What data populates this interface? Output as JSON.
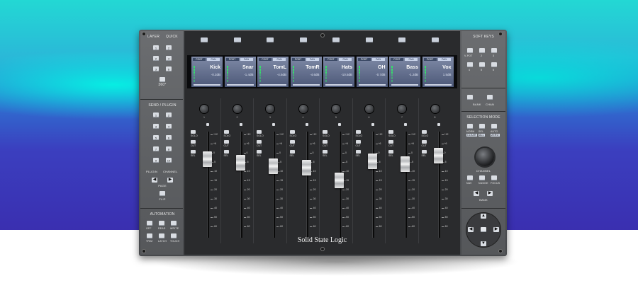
{
  "brand": "Solid State Logic",
  "left_panel": {
    "layer_label": "LAYER",
    "quick_label": "QUICK",
    "layer_numbers": [
      "1",
      "2",
      "3"
    ],
    "quick_numbers": [
      "1",
      "2",
      "3",
      "4",
      "5",
      "6"
    ],
    "ssl360_label": "360°",
    "send_plugin_label": "SEND / PLUGIN",
    "send_numbers": [
      "1",
      "2",
      "3",
      "4",
      "5",
      "6",
      "7",
      "8",
      "9",
      "10"
    ],
    "plugin_label": "PLUGIN",
    "channel_label": "CHANNEL",
    "page_label": "PAGE",
    "flip_label": "FLIP",
    "automation_label": "AUTOMATION",
    "automation_buttons": [
      "OFF",
      "READ",
      "WRITE",
      "TRIM",
      "LATCH",
      "TOUCH"
    ]
  },
  "channels": [
    {
      "name": "Kick",
      "value": "-0.2dB"
    },
    {
      "name": "Snar",
      "value": "-1.4dB"
    },
    {
      "name": "TomL",
      "value": "-4.5dB"
    },
    {
      "name": "TomR",
      "value": "-4.6dB"
    },
    {
      "name": "Hats",
      "value": "-10.5dB"
    },
    {
      "name": "OH",
      "value": "-0.7dB"
    },
    {
      "name": "Bass",
      "value": "-1.2dB"
    },
    {
      "name": "Vox",
      "value": "1.5dB"
    }
  ],
  "channel_numbers": [
    "1",
    "2",
    "3",
    "4",
    "5",
    "6",
    "7",
    "8"
  ],
  "lcd_tabs": [
    "POST",
    "PAN"
  ],
  "strip_buttons": [
    "SOLO",
    "CUT",
    "SEL"
  ],
  "fader_scale": [
    "+12",
    "+6",
    "0",
    "-5",
    "-10",
    "-15",
    "-20",
    "-30",
    "-40",
    "-50",
    "-60"
  ],
  "fader_levels": [
    0.78,
    0.74,
    0.7,
    0.69,
    0.55,
    0.76,
    0.73,
    0.82
  ],
  "right_panel": {
    "soft_keys_label": "SOFT KEYS",
    "vpot_label": "V-POT",
    "soft_numbers": [
      "1",
      "2",
      "3",
      "4",
      "5",
      "6"
    ],
    "bank_label": "BANK",
    "chan_label": "CHAN",
    "selection_mode_label": "SELECTION MODE",
    "mode_buttons": [
      "NORM",
      "SEL",
      "AUTO"
    ],
    "mode_sublabels": [
      "CLEAR",
      "ALL",
      "ZERO"
    ],
    "channel_knob_label": "CHANNEL",
    "nav_buttons": [
      "NAV",
      "NUDGE",
      "FOCUS"
    ],
    "bank_nav_label": "BANK"
  }
}
